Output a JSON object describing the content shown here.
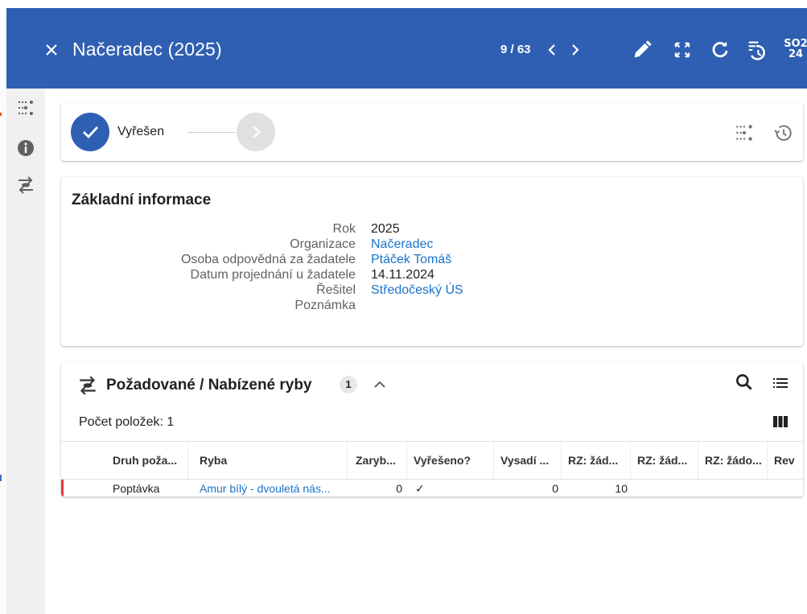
{
  "header": {
    "title": "Načeradec (2025)",
    "pager": "9 / 63",
    "badge_top": "SO2",
    "badge_bottom": "24",
    "bg_color": "#2f5fb3"
  },
  "workflow": {
    "state_label": "Vyřešen"
  },
  "basic_info": {
    "title": "Základní informace",
    "fields": [
      {
        "label": "Rok",
        "value": "2025"
      },
      {
        "label": "Organizace",
        "value": "Načeradec"
      },
      {
        "label": "Osoba odpovědná za žadatele",
        "value": "Ptáček Tomáš"
      },
      {
        "label": "Datum projednání u žadatele",
        "value": "14.11.2024"
      },
      {
        "label": "Řešitel",
        "value": "Středočeský ÚS"
      },
      {
        "label": "Poznámka",
        "value": ""
      }
    ]
  },
  "fish": {
    "title": "Požadované / Nabízené ryby",
    "badge": "1",
    "count_text": "Počet položek: 1",
    "columns": [
      "Druh poža...",
      "Ryba",
      "Zaryb...",
      "Vyřešeno?",
      "Vysadí ...",
      "RZ: žád...",
      "RZ: žád...",
      "RZ: žádo...",
      "Rev"
    ],
    "rows": [
      {
        "druh": "Poptávka",
        "ryba": "Amur bílý - dvouletá nás...",
        "zaryb": "0",
        "vyreseno": "✓",
        "vysadi": "0",
        "rz1": "10",
        "rz2": "",
        "rz3": "",
        "rev": ""
      }
    ]
  }
}
